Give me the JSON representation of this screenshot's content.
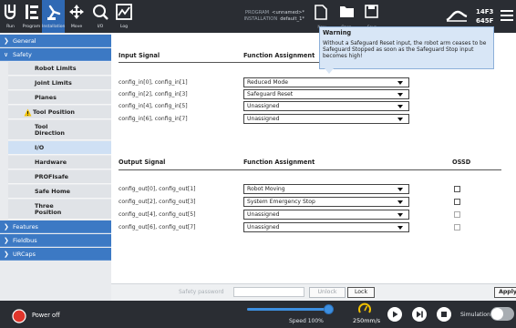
{
  "topbar": {
    "nav": [
      {
        "label": "Run",
        "icon": "ur-logo-icon"
      },
      {
        "label": "Program",
        "icon": "program-icon"
      },
      {
        "label": "Installation",
        "icon": "installation-icon"
      },
      {
        "label": "Move",
        "icon": "move-icon"
      },
      {
        "label": "I/O",
        "icon": "io-icon"
      },
      {
        "label": "Log",
        "icon": "log-icon"
      }
    ],
    "program_key": "PROGRAM",
    "program_value": "<unnamed>*",
    "installation_key": "INSTALLATION",
    "installation_value": "default_1*",
    "new_label": "New",
    "open_label": "Open",
    "save_label": "Save",
    "robot_id_line1": "14F3",
    "robot_id_line2": "645F"
  },
  "sidebar": {
    "general": "General",
    "safety": "Safety",
    "items": [
      "Robot Limits",
      "Joint Limits",
      "Planes",
      "Tool Position",
      "Tool Direction",
      "I/O",
      "Hardware",
      "PROFIsafe",
      "Safe Home",
      "Three Position"
    ],
    "features": "Features",
    "fieldbus": "Fieldbus",
    "urcaps": "URCaps"
  },
  "input": {
    "header_signal": "Input Signal",
    "header_function": "Function Assignment",
    "rows": [
      {
        "signal": "config_in[0], config_in[1]",
        "value": "Reduced Mode"
      },
      {
        "signal": "config_in[2], config_in[3]",
        "value": "Safeguard Reset"
      },
      {
        "signal": "config_in[4], config_in[5]",
        "value": "Unassigned"
      },
      {
        "signal": "config_in[6], config_in[7]",
        "value": "Unassigned"
      }
    ]
  },
  "output": {
    "header_signal": "Output Signal",
    "header_function": "Function Assignment",
    "header_ossd": "OSSD",
    "rows": [
      {
        "signal": "config_out[0], config_out[1]",
        "value": "Robot Moving"
      },
      {
        "signal": "config_out[2], config_out[3]",
        "value": "System Emergency Stop"
      },
      {
        "signal": "config_out[4], config_out[5]",
        "value": "Unassigned"
      },
      {
        "signal": "config_out[6], config_out[7]",
        "value": "Unassigned"
      }
    ]
  },
  "warning": {
    "title": "Warning",
    "body": "Without a Safeguard Reset input, the robot arm ceases to be Safeguard Stopped as soon as the Safeguard Stop input becomes high!"
  },
  "password": {
    "placeholder": "Safety password",
    "unlock": "Unlock",
    "lock": "Lock",
    "apply": "Apply"
  },
  "bottom": {
    "power": "Power off",
    "speed_label": "Speed 100%",
    "speed_fraction": 1.0,
    "mm_label": "250mm/s",
    "simulation": "Simulation"
  },
  "colors": {
    "accent": "#3c79c4",
    "bar": "#2a2d33",
    "power": "#e0352b"
  }
}
